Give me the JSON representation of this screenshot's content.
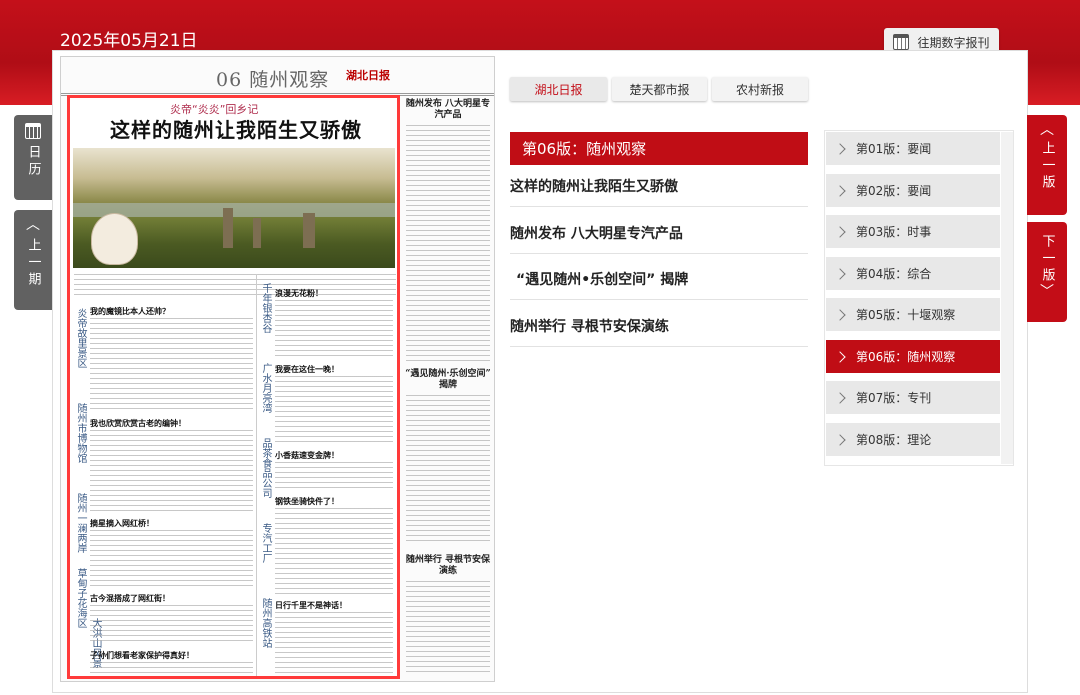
{
  "header": {
    "date": "2025年05月21日",
    "archive_label": "往期数字报刊"
  },
  "left_tabs": {
    "calendar_label": "日历",
    "prev_period_label": "上一期"
  },
  "right_tabs": {
    "prev_page_label": "上一版",
    "next_page_label": "下一版"
  },
  "paper_tabs": [
    {
      "label": "湖北日报",
      "active": true
    },
    {
      "label": "楚天都市报",
      "active": false
    },
    {
      "label": "农村新报",
      "active": false
    }
  ],
  "newspaper": {
    "page_heading": "06 随州观察",
    "logo_text": "湖北日报",
    "main_kicker": "炎帝“炎炎”回乡记",
    "main_title": "这样的随州让我陌生又骄傲",
    "side_heads": [
      "炎帝故里景区",
      "随州市博物馆",
      "随州一澜两岸",
      "草甸子花海",
      "大洪山风景区"
    ],
    "mid_heads": [
      "千年银杏谷",
      "广水月亮湾",
      "品茶食品公司",
      "专汽工厂",
      "随州高铁站"
    ],
    "sub_heads": [
      "我的魔镜比本人还帅？",
      "我也欣赏欣赏古老的编钟！",
      "摘星摘入网红桥！",
      "古今混搭成了网红街！",
      "子孙们想看老家保护得真好！",
      "浪漫无花粉！",
      "我要在这住一晚！",
      "小香菇速变金牌！",
      "钢铁坐骑快件了！",
      "日行千里不是神话！"
    ],
    "right_titles": [
      "随州发布 八大明星专汽产品",
      "“遇见随州·乐创空间” 揭牌",
      "随州举行 寻根节安保演练"
    ]
  },
  "edition": {
    "title": "第06版：随州观察",
    "articles": [
      "这样的随州让我陌生又骄傲",
      "随州发布 八大明星专汽产品",
      "“遇见随州•乐创空间” 揭牌",
      "随州举行 寻根节安保演练"
    ]
  },
  "pages": [
    {
      "label": "第01版：要闻",
      "active": false
    },
    {
      "label": "第02版：要闻",
      "active": false
    },
    {
      "label": "第03版：时事",
      "active": false
    },
    {
      "label": "第04版：综合",
      "active": false
    },
    {
      "label": "第05版：十堰观察",
      "active": false
    },
    {
      "label": "第06版：随州观察",
      "active": true
    },
    {
      "label": "第07版：专刊",
      "active": false
    },
    {
      "label": "第08版：理论",
      "active": false
    }
  ],
  "colors": {
    "brand_red": "#c00d15",
    "highlight_border": "#ff3a3a"
  }
}
